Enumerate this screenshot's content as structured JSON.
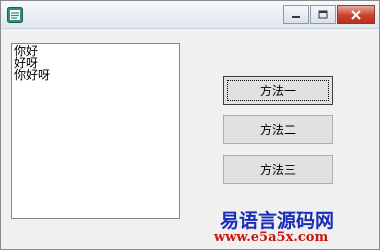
{
  "window": {
    "title": "",
    "icon": "app-window-icon",
    "controls": {
      "minimize": "minimize-icon",
      "maximize": "maximize-icon",
      "close": "close-icon"
    }
  },
  "editbox": {
    "lines": [
      "你好",
      "好呀",
      "你好呀"
    ]
  },
  "buttons": {
    "method1": "方法一",
    "method2": "方法二",
    "method3": "方法三"
  },
  "watermark": {
    "site_name": "易语言源码网",
    "url": "www.e5a5x.com",
    "name_color": "#1a2db8",
    "url_color": "#c8170d"
  }
}
